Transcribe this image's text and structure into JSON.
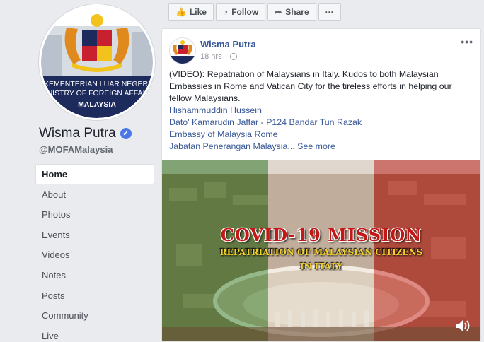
{
  "page": {
    "name": "Wisma Putra",
    "handle": "@MOFAMalaysia",
    "logo_text_line1": "KEMENTERIAN LUAR NEGERI",
    "logo_text_line2": "MINISTRY OF FOREIGN AFFAIRS",
    "logo_text_line3": "MALAYSIA"
  },
  "nav": {
    "items": [
      {
        "label": "Home"
      },
      {
        "label": "About"
      },
      {
        "label": "Photos"
      },
      {
        "label": "Events"
      },
      {
        "label": "Videos"
      },
      {
        "label": "Notes"
      },
      {
        "label": "Posts"
      },
      {
        "label": "Community"
      },
      {
        "label": "Live"
      }
    ]
  },
  "actions": {
    "like": "Like",
    "follow": "Follow",
    "share": "Share",
    "more": "···"
  },
  "post": {
    "author": "Wisma Putra",
    "time": "18 hrs",
    "more": "•••",
    "text": "(VIDEO): Repatriation of Malaysians in Italy. Kudos to both Malaysian Embassies in Rome and Vatican City for the tireless efforts in helping our fellow Malaysians.",
    "links": [
      "Hishammuddin Hussein",
      "Dato' Kamarudin Jaffar - P124 Bandar Tun Razak",
      "Embassy of Malaysia Rome"
    ],
    "last_link": "Jabatan Penerangan Malaysia...",
    "see_more": "See more"
  },
  "video": {
    "title": "COVID-19 MISSION",
    "subtitle1": "REPATRIATION OF MALAYSIAN CITIZENS",
    "subtitle2": "IN ITALY"
  },
  "colors": {
    "link": "#385898",
    "verified": "#4a76e8",
    "logo_navy": "#1c2a5c"
  }
}
